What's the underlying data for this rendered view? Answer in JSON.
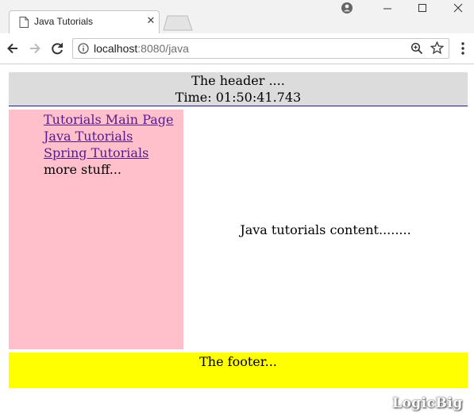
{
  "browser": {
    "tab": {
      "title": "Java Tutorials",
      "close_glyph": "✕",
      "favicon": "page-icon"
    },
    "window_controls": [
      "profile-icon",
      "minimize-icon",
      "maximize-icon",
      "close-icon"
    ],
    "toolbar": {
      "nav_icons": [
        "back-arrow-icon",
        "forward-arrow-icon",
        "reload-icon"
      ]
    },
    "address": {
      "host": "localhost",
      "rest": ":8080/java",
      "icons": [
        "info-icon",
        "zoom-icon",
        "bookmark-star-icon"
      ]
    },
    "menu_icon": "more-vertical-icon"
  },
  "page": {
    "header": {
      "line1": "The header ....",
      "line2": "Time: 01:50:41.743",
      "bg": "#dcdcdc"
    },
    "sidebar": {
      "bg": "#ffc0cb",
      "links": [
        "Tutorials Main Page",
        "Java Tutorials",
        "Spring Tutorials"
      ],
      "extra": "more stuff..."
    },
    "content": {
      "text": "Java tutorials content........"
    },
    "footer": {
      "text": "The footer...",
      "bg": "#ffff00"
    }
  },
  "watermark": "LogicBig"
}
